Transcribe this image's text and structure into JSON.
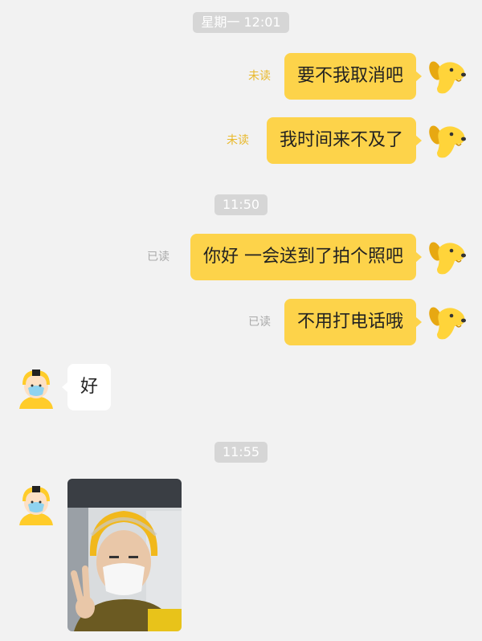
{
  "timestamps": [
    "星期一 12:01",
    "11:50",
    "11:55"
  ],
  "messages": {
    "m1": {
      "text": "要不我取消吧",
      "status": "未读"
    },
    "m2": {
      "text": "我时间来不及了",
      "status": "未读"
    },
    "m3": {
      "text": "你好 一会送到了拍个照吧",
      "status": "已读"
    },
    "m4": {
      "text": "不用打电话哦",
      "status": "已读"
    },
    "r1": {
      "text": "好"
    }
  },
  "icons": {
    "self_avatar": "yellow-dog-icon",
    "courier_avatar": "courier-helmet-icon",
    "photo": "courier-selfie-photo"
  },
  "colors": {
    "background": "#f2f2f2",
    "my_bubble": "#fdd34a",
    "unread": "#e9b92c",
    "read": "#a9a9a9",
    "timestamp_bg": "#d6d6d6"
  }
}
